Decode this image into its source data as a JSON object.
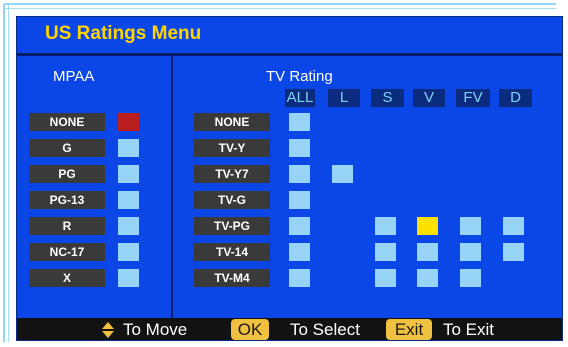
{
  "menu": {
    "title": "US Ratings Menu"
  },
  "mpaa": {
    "heading": "MPAA",
    "ratings": [
      {
        "label": "NONE",
        "state": "blocked"
      },
      {
        "label": "G",
        "state": "open"
      },
      {
        "label": "PG",
        "state": "open"
      },
      {
        "label": "PG-13",
        "state": "open"
      },
      {
        "label": "R",
        "state": "open"
      },
      {
        "label": "NC-17",
        "state": "open"
      },
      {
        "label": "X",
        "state": "open"
      }
    ]
  },
  "tv": {
    "heading": "TV Rating",
    "columns": [
      "ALL",
      "L",
      "S",
      "V",
      "FV",
      "D"
    ],
    "ratings": [
      {
        "label": "NONE",
        "cells": [
          "open",
          null,
          null,
          null,
          null,
          null
        ]
      },
      {
        "label": "TV-Y",
        "cells": [
          "open",
          null,
          null,
          null,
          null,
          null
        ]
      },
      {
        "label": "TV-Y7",
        "cells": [
          "open",
          "open",
          null,
          null,
          null,
          null
        ]
      },
      {
        "label": "TV-G",
        "cells": [
          "open",
          null,
          null,
          null,
          null,
          null
        ]
      },
      {
        "label": "TV-PG",
        "cells": [
          "open",
          null,
          "open",
          "selected",
          "open",
          "open"
        ]
      },
      {
        "label": "TV-14",
        "cells": [
          "open",
          null,
          "open",
          "open",
          "open",
          "open"
        ]
      },
      {
        "label": "TV-M4",
        "cells": [
          "open",
          null,
          "open",
          "open",
          "open",
          null
        ]
      }
    ]
  },
  "footer": {
    "move_label": "To Move",
    "ok_key": "OK",
    "select_label": "To Select",
    "exit_key": "Exit",
    "exit_label": "To Exit"
  },
  "colors": {
    "background": "#0b46e6",
    "title": "#ffd400",
    "label_bg": "#3a3a3a",
    "open": "#97d4f7",
    "blocked": "#bb1e1e",
    "selected": "#ffe100",
    "footer_bg": "#121212",
    "button_bg": "#f0c040"
  }
}
